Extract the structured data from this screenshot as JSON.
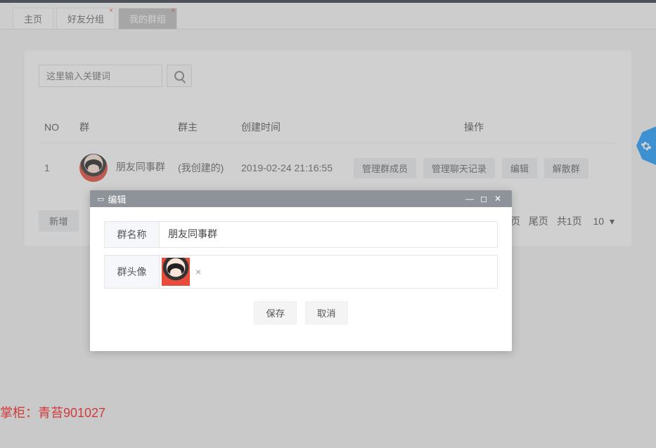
{
  "tabs": {
    "home": "主页",
    "friend_groups": "好友分组",
    "my_groups": "我的群组"
  },
  "search": {
    "placeholder": "这里输入关键词"
  },
  "table": {
    "headers": {
      "no": "NO",
      "group": "群",
      "owner": "群主",
      "created_at": "创建时间",
      "action": "操作"
    },
    "rows": [
      {
        "no": "1",
        "group_name": "朋友同事群",
        "owner": "(我创建的)",
        "created_at": "2019-02-24 21:16:55"
      }
    ],
    "actions": {
      "manage_members": "管理群成员",
      "manage_chat_logs": "管理聊天记录",
      "edit": "编辑",
      "dissolve": "解散群"
    },
    "add_button": "新增"
  },
  "pager": {
    "next": "下页",
    "last": "尾页",
    "total": "共1页",
    "per_page": "10"
  },
  "modal": {
    "title": "编辑",
    "fields": {
      "group_name_label": "群名称",
      "group_name_value": "朋友同事群",
      "group_avatar_label": "群头像"
    },
    "buttons": {
      "save": "保存",
      "cancel": "取消"
    }
  },
  "watermark": "掌柜：青苔901027"
}
